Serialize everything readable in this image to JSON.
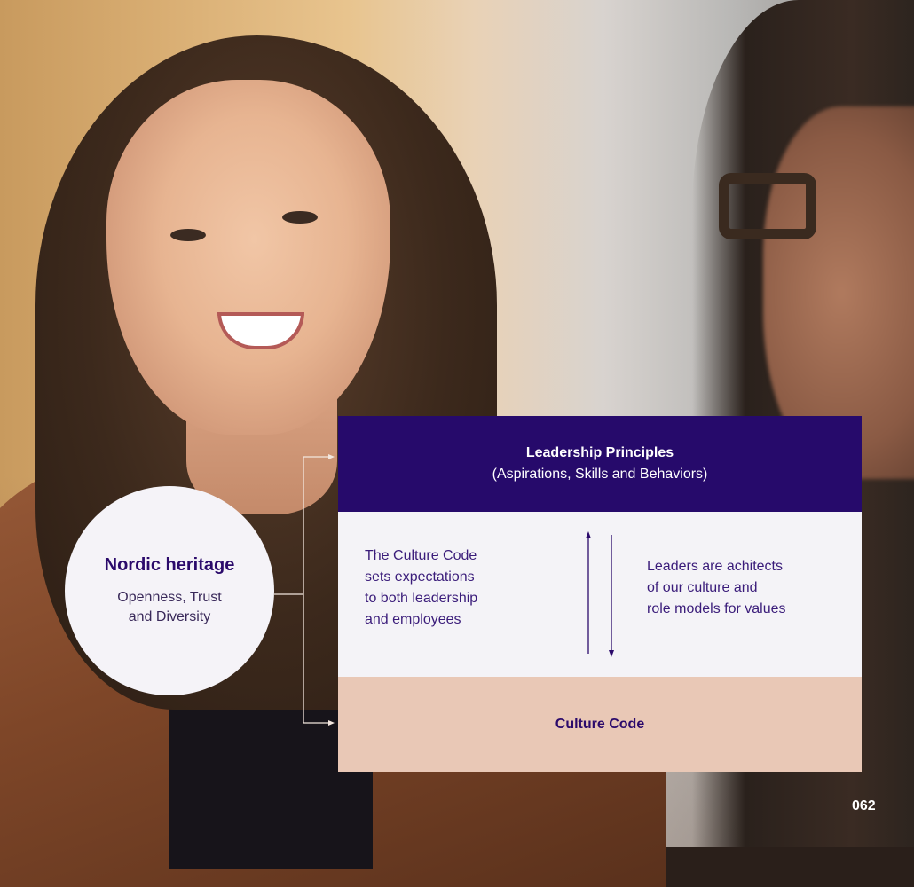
{
  "diagram": {
    "heritage": {
      "title": "Nordic heritage",
      "subtitle_line1": "Openness, Trust",
      "subtitle_line2": "and Diversity"
    },
    "leadership": {
      "title": "Leadership Principles",
      "subtitle": "(Aspirations, Skills and Behaviors)"
    },
    "middle": {
      "left_lines": [
        "The Culture Code",
        "sets expectations",
        "to both leadership",
        "and employees"
      ],
      "right_lines": [
        "Leaders are achitects",
        "of our culture and",
        "role models for values"
      ]
    },
    "culture_code": "Culture Code"
  },
  "page_number": "062",
  "colors": {
    "leadership_bg": "#260a6b",
    "middle_bg": "#f4f3f7",
    "culture_bg": "#e9c8b6",
    "heading_text": "#2b0a6b"
  }
}
